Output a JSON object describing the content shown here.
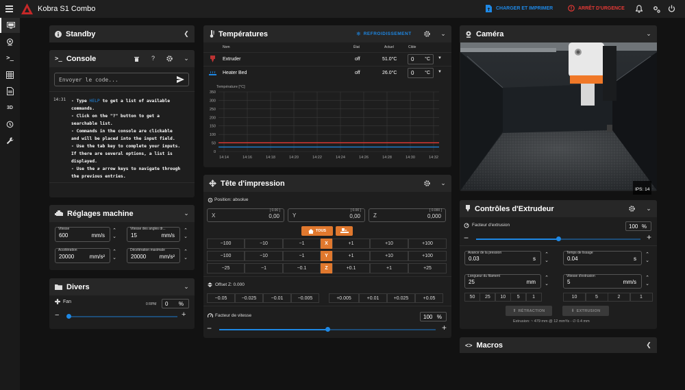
{
  "app": {
    "title": "Kobra S1 Combo"
  },
  "header": {
    "print_button": "CHARGER ET IMPRIMER",
    "emergency_button": "ARRÊT D'URGENCE"
  },
  "colors": {
    "accent": "#1e88e5",
    "orange": "#e0782e",
    "danger": "#e53935",
    "extruder_line": "#e53935",
    "bed_line": "#1e88e5"
  },
  "sidebar": {
    "items": [
      {
        "icon": "dashboard-icon"
      },
      {
        "icon": "webcam-icon"
      },
      {
        "icon": "console-icon"
      },
      {
        "icon": "heightmap-icon"
      },
      {
        "icon": "files-icon"
      },
      {
        "label": "3D"
      },
      {
        "icon": "history-icon"
      },
      {
        "icon": "wrench-icon"
      }
    ]
  },
  "standby": {
    "title": "Standby"
  },
  "console": {
    "title": "Console",
    "help_label": "?",
    "placeholder": "Envoyer le code...",
    "time": "14:31",
    "lines": [
      {
        "pre": "- Type ",
        "hl": "HELP",
        "post": " to get a list of available"
      },
      {
        "text": "commands."
      },
      {
        "text": "- Click on the \"?\" button to get a"
      },
      {
        "text": "searchable list."
      },
      {
        "text": "- Commands in the console are clickable"
      },
      {
        "text": "and will be placed into the input field."
      },
      {
        "text": "- Use the tab key to complete your inputs."
      },
      {
        "text": "If there are several options, a list is"
      },
      {
        "text": "displayed."
      },
      {
        "text": "- Use the ⇵ arrow keys to navigate through"
      },
      {
        "text": "the previous entries."
      }
    ]
  },
  "machine": {
    "title": "Réglages machine",
    "velocity": {
      "label": "Vitesse",
      "value": "600",
      "unit": "mm/s"
    },
    "corner": {
      "label": "Vitesse des angles dr...",
      "value": "15",
      "unit": "mm/s"
    },
    "accel": {
      "label": "Accélération",
      "value": "20000",
      "unit": "mm/s²"
    },
    "decel": {
      "label": "Décélération maximale",
      "value": "20000",
      "unit": "mm/s²"
    }
  },
  "divers": {
    "title": "Divers",
    "fan_label": "Fan",
    "fan_rpm": "0 RPM",
    "fan_value": "0",
    "fan_unit": "%",
    "fan_level": 0
  },
  "temps": {
    "title": "Températures",
    "cooldown": "REFROIDISSEMENT",
    "headers": {
      "name": "Nom",
      "state": "État",
      "actual": "Actuel",
      "target": "Cible"
    },
    "rows": [
      {
        "name": "Extruder",
        "state": "off",
        "actual": "51.0°C",
        "target": "0",
        "unit": "°C"
      },
      {
        "name": "Heater Bed",
        "state": "off",
        "actual": "26.0°C",
        "target": "0",
        "unit": "°C"
      }
    ]
  },
  "chart_data": {
    "type": "line",
    "ylabel": "Température [°C]",
    "yticks": [
      "350",
      "300",
      "250",
      "200",
      "150",
      "100",
      "50",
      "0"
    ],
    "ylim": [
      0,
      350
    ],
    "xticks": [
      "14:14",
      "14:16",
      "14:18",
      "14:20",
      "14:22",
      "14:24",
      "14:26",
      "14:28",
      "14:30",
      "14:32"
    ],
    "grid": true,
    "series": [
      {
        "name": "Extruder",
        "values": [
          51,
          51
        ]
      },
      {
        "name": "Heater Bed",
        "values": [
          26,
          26
        ]
      }
    ]
  },
  "head": {
    "title": "Tête d'impression",
    "position_label": "Position: absolue",
    "x": {
      "label": "X",
      "value": "0,00",
      "hint": "[ 0.00 ]"
    },
    "y": {
      "label": "Y",
      "value": "0,00",
      "hint": "[ 0.00 ]"
    },
    "z": {
      "label": "Z",
      "value": "0,000",
      "hint": "[ 0.000 ]"
    },
    "home_all": "TOUS",
    "rows": [
      {
        "axis": "X",
        "neg": [
          "−100",
          "−10",
          "−1"
        ],
        "pos": [
          "+1",
          "+10",
          "+100"
        ]
      },
      {
        "axis": "Y",
        "neg": [
          "−100",
          "−10",
          "−1"
        ],
        "pos": [
          "+1",
          "+10",
          "+100"
        ]
      },
      {
        "axis": "Z",
        "neg": [
          "−25",
          "−1",
          "−0.1"
        ],
        "pos": [
          "+0.1",
          "+1",
          "+25"
        ]
      }
    ],
    "zoffset_label": "Offset Z: 0.000",
    "zoffset_neg": [
      "−0.05",
      "−0.025",
      "−0.01",
      "−0.005"
    ],
    "zoffset_pos": [
      "+0.005",
      "+0.01",
      "+0.025",
      "+0.05"
    ],
    "speed_label": "Facteur de vitesse",
    "speed_value": "100",
    "speed_unit": "%",
    "speed_level": 0.5
  },
  "camera": {
    "title": "Caméra",
    "fps": "IPS: 14"
  },
  "extruder": {
    "title": "Contrôles d'Extrudeur",
    "factor_label": "Facteur d'extrusion",
    "factor_value": "100",
    "factor_unit": "%",
    "factor_level": 0.5,
    "pa_label": "Avance de la pression",
    "pa_value": "0.03",
    "pa_unit": "s",
    "smooth_label": "Temps de lissage",
    "smooth_value": "0.04",
    "smooth_unit": "s",
    "len_label": "Longueur du filament",
    "len_value": "25",
    "len_unit": "mm",
    "spd_label": "Vitesse d'extrusion",
    "spd_value": "5",
    "spd_unit": "mm/s",
    "len_presets": [
      "50",
      "25",
      "10",
      "5",
      "1"
    ],
    "spd_presets": [
      "10",
      "5",
      "2",
      "1"
    ],
    "retract": "RÉTRACTION",
    "extrude": "EXTRUSION",
    "info": "Extrusion: ~ 479 mm @ 12 mm³/s - ∅ 0.4 mm"
  },
  "macros": {
    "title": "Macros"
  }
}
